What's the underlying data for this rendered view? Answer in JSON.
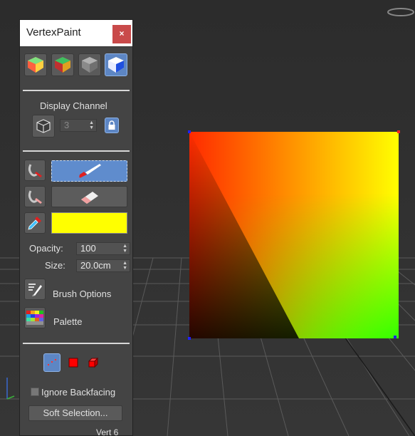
{
  "window": {
    "title": "VertexPaint",
    "close_symbol": "×"
  },
  "top_tools": [
    {
      "name": "vertex-color-display-shaded-icon",
      "active": false
    },
    {
      "name": "vertex-color-display-unshaded-icon",
      "active": false
    },
    {
      "name": "disable-vertex-color-display-icon",
      "active": false
    },
    {
      "name": "vertex-color-display-ambient-icon",
      "active": true
    }
  ],
  "display_channel": {
    "label": "Display Channel",
    "value": "3",
    "lock_icon": "lock-icon"
  },
  "paint": {
    "brush_active": true,
    "erase_active": false,
    "color": "#ffff00",
    "opacity_label": "Opacity:",
    "opacity_value": "100",
    "size_label": "Size:",
    "size_value": "20.0cm"
  },
  "brush_options": {
    "label": "Brush Options"
  },
  "palette": {
    "label": "Palette"
  },
  "selection_modes": [
    {
      "name": "vertex-selection-icon",
      "active": true
    },
    {
      "name": "face-selection-icon",
      "active": false
    },
    {
      "name": "element-selection-icon",
      "active": false
    }
  ],
  "ignore_backfacing": {
    "label": "Ignore Backfacing",
    "checked": false
  },
  "soft_selection": {
    "label": "Soft Selection..."
  },
  "status": {
    "text": "Vert 6"
  },
  "colors": {
    "accent": "#5d86c4",
    "panel": "#444444",
    "swatch": "#ffff00",
    "close": "#c94a4a"
  }
}
